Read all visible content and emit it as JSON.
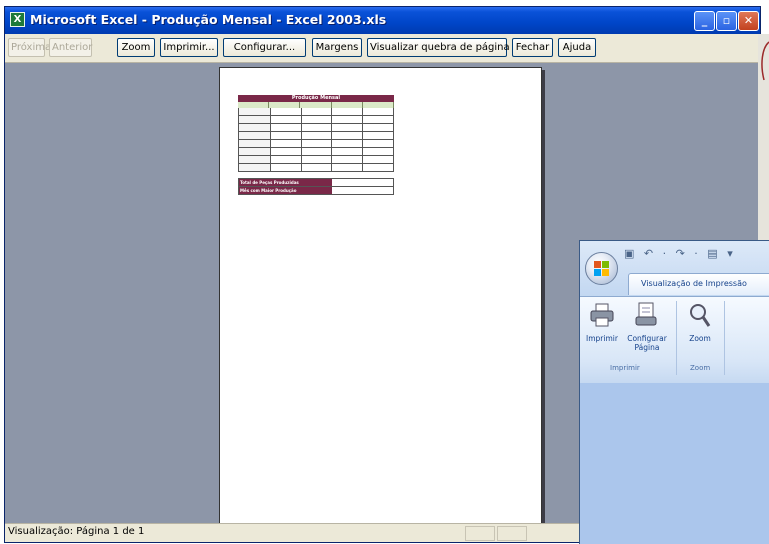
{
  "window": {
    "title": "Microsoft Excel - Produção Mensal - Excel 2003.xls",
    "app_icon": "excel-icon",
    "controls": {
      "minimize": "_",
      "maximize": "▫",
      "close": "✕"
    }
  },
  "toolbar": {
    "buttons": [
      {
        "label": "Próxima",
        "enabled": false
      },
      {
        "label": "Anterior",
        "enabled": false
      },
      {
        "label": "Zoom",
        "enabled": true
      },
      {
        "label": "Imprimir...",
        "enabled": true
      },
      {
        "label": "Configurar...",
        "enabled": true
      },
      {
        "label": "Margens",
        "enabled": true
      },
      {
        "label": "Visualizar quebra de página",
        "enabled": true
      },
      {
        "label": "Fechar",
        "enabled": true
      },
      {
        "label": "Ajuda",
        "enabled": true
      }
    ]
  },
  "sheet": {
    "title": "Produção Mensal",
    "summary": [
      {
        "label": "Total de Peças Produzidas",
        "value": ""
      },
      {
        "label": "Mês com Maior Produção",
        "value": ""
      }
    ]
  },
  "status": {
    "text": "Visualização: Página 1 de 1"
  },
  "office2007": {
    "qat": "▣ ↶ · ↷ · ▤ ▾",
    "tab": "Visualização de Impressão",
    "buttons": [
      {
        "label": "Imprimir",
        "icon": "printer-icon"
      },
      {
        "label": "Configurar Página",
        "icon": "page-setup-icon"
      },
      {
        "label": "Zoom",
        "icon": "magnifier-icon"
      }
    ],
    "groups": [
      "Imprimir",
      "Zoom"
    ]
  },
  "colors": {
    "title_bar": "#0045c8",
    "sheet_header": "#7a2848",
    "preview_bg": "#8d96a8"
  }
}
